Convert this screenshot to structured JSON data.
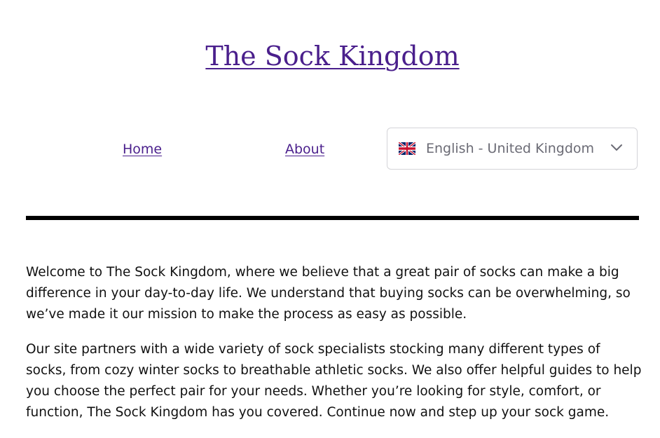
{
  "site": {
    "title": "The Sock Kingdom"
  },
  "nav": {
    "items": [
      {
        "label": "Home"
      },
      {
        "label": "About"
      }
    ]
  },
  "language_select": {
    "selected": "English - United Kingdom",
    "flag_icon": "uk-flag-icon",
    "caret_icon": "chevron-down-icon"
  },
  "content": {
    "paragraphs": [
      "Welcome to The Sock Kingdom, where we believe that a great pair of socks can make a big difference in your day-to-day life. We understand that buying socks can be overwhelming, so we’ve made it our mission to make the process as easy as possible.",
      "Our site partners with a wide variety of sock specialists stocking many different types of socks, from cozy winter socks to breathable athletic socks. We also offer helpful guides to help you choose the perfect pair for your needs. Whether you’re looking for style, comfort, or function, The Sock Kingdom has you covered. Continue now and step up your sock game."
    ]
  },
  "colors": {
    "link": "#4a1f8c",
    "divider": "#000000",
    "select_border": "#d4d4d8",
    "select_text": "#6b6b75"
  }
}
